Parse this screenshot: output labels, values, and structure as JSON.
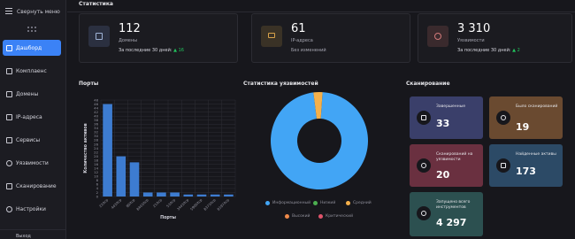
{
  "sidebar": {
    "collapse_label": "Свернуть меню",
    "items": [
      {
        "label": "Дашборд",
        "active": true
      },
      {
        "label": "Комплаенс",
        "active": false
      },
      {
        "label": "Домены",
        "active": false
      },
      {
        "label": "IP-адреса",
        "active": false
      },
      {
        "label": "Сервисы",
        "active": false
      },
      {
        "label": "Уязвимости",
        "active": false
      },
      {
        "label": "Сканирование",
        "active": false
      },
      {
        "label": "Настройки",
        "active": false
      }
    ],
    "bottom_label": "Выход"
  },
  "stats": {
    "title": "Статистика",
    "cards": [
      {
        "value": "112",
        "label": "Домены",
        "sub": "За последние 30 дней:",
        "arrow": "▲",
        "delta": "16",
        "icon": "folder-icon",
        "icon_bg": "#2b3040",
        "icon_color": "#9fb3d6"
      },
      {
        "value": "61",
        "label": "IP-адреса",
        "sub": "Без изменений",
        "arrow": "",
        "delta": "",
        "icon": "monitor-icon",
        "icon_bg": "#3a3226",
        "icon_color": "#d8a24a"
      },
      {
        "value": "3 310",
        "label": "Уязвимости",
        "sub": "За последние 30 дней:",
        "arrow": "▲",
        "delta": "2",
        "icon": "alert-icon",
        "icon_bg": "#3a2a2d",
        "icon_color": "#d27a7a"
      }
    ]
  },
  "ports": {
    "title": "Порты",
    "chart_data": {
      "type": "bar",
      "categories": [
        "22/tcp",
        "443/tcp",
        "80/tcp",
        "8443/tcp",
        "21/tcp",
        "53/tcp",
        "3443/tcp",
        "5900/tcp",
        "8373/tcp",
        "8197/tcp"
      ],
      "values": [
        46,
        20,
        17,
        2,
        2,
        2,
        1,
        1,
        1,
        1
      ],
      "xlabel": "Порты",
      "ylabel": "Количество активов",
      "yticks": [
        "0",
        "2",
        "4",
        "6",
        "8",
        "10",
        "12",
        "14",
        "16",
        "18",
        "20",
        "22",
        "24",
        "26",
        "28",
        "30",
        "32",
        "34",
        "36",
        "38",
        "40",
        "42",
        "44",
        "46",
        "48"
      ],
      "ylim": [
        0,
        48
      ],
      "color": "#3d7cd1"
    }
  },
  "vulns": {
    "title": "Статистика уязвимостей",
    "chart_data": {
      "type": "pie",
      "labels": [
        "Информационный",
        "Низкий",
        "Средний",
        "Высокий",
        "Критический"
      ],
      "values": [
        97,
        0,
        3,
        0,
        0
      ],
      "colors": [
        "#42a5f5",
        "#4caf50",
        "#f5b04a",
        "#ef8a4a",
        "#e0536a"
      ]
    }
  },
  "scan": {
    "title": "Сканирование",
    "cards": [
      {
        "title": "Завершенные",
        "value": "33",
        "bg": "#3a3f6a",
        "icon": "copy-icon"
      },
      {
        "title": "Было сканирований",
        "value": "19",
        "bg": "#6a4a30",
        "icon": "search-icon"
      },
      {
        "title": "Сканирований на уязвимости",
        "value": "20",
        "bg": "#6a3040",
        "icon": "search-icon"
      },
      {
        "title": "Найденные активы",
        "value": "173",
        "bg": "#2c4a66",
        "icon": "box-icon"
      },
      {
        "title": "Запущено всего инструментов",
        "value": "4 297",
        "bg": "#2c5050",
        "icon": "gear-icon"
      }
    ]
  }
}
